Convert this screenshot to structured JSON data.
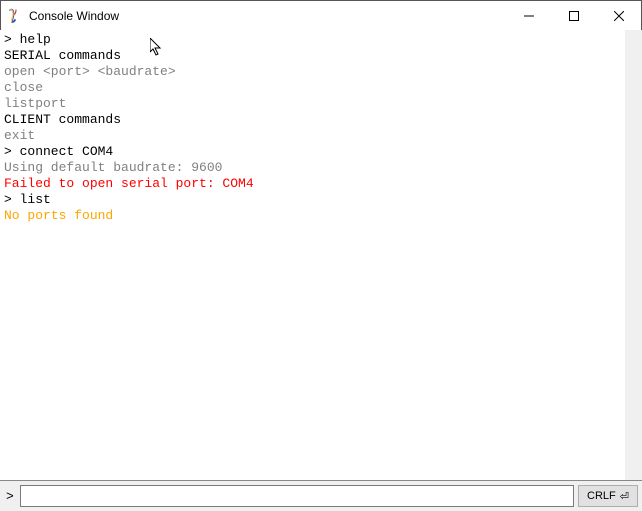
{
  "window": {
    "title": "Console Window"
  },
  "console": {
    "lines": [
      {
        "text": "> help",
        "color": "black"
      },
      {
        "text": "SERIAL commands",
        "color": "black"
      },
      {
        "text": "open <port> <baudrate>",
        "color": "gray"
      },
      {
        "text": "close",
        "color": "gray"
      },
      {
        "text": "listport",
        "color": "gray"
      },
      {
        "text": "CLIENT commands",
        "color": "black"
      },
      {
        "text": "exit",
        "color": "gray"
      },
      {
        "text": "> connect COM4",
        "color": "black"
      },
      {
        "text": "Using default baudrate: 9600",
        "color": "gray"
      },
      {
        "text": "Failed to open serial port: COM4",
        "color": "red"
      },
      {
        "text": "> list",
        "color": "black"
      },
      {
        "text": "No ports found",
        "color": "orange"
      }
    ]
  },
  "input": {
    "prompt": ">",
    "value": "",
    "mode_label": "CRLF",
    "return_glyph": "⏎"
  }
}
